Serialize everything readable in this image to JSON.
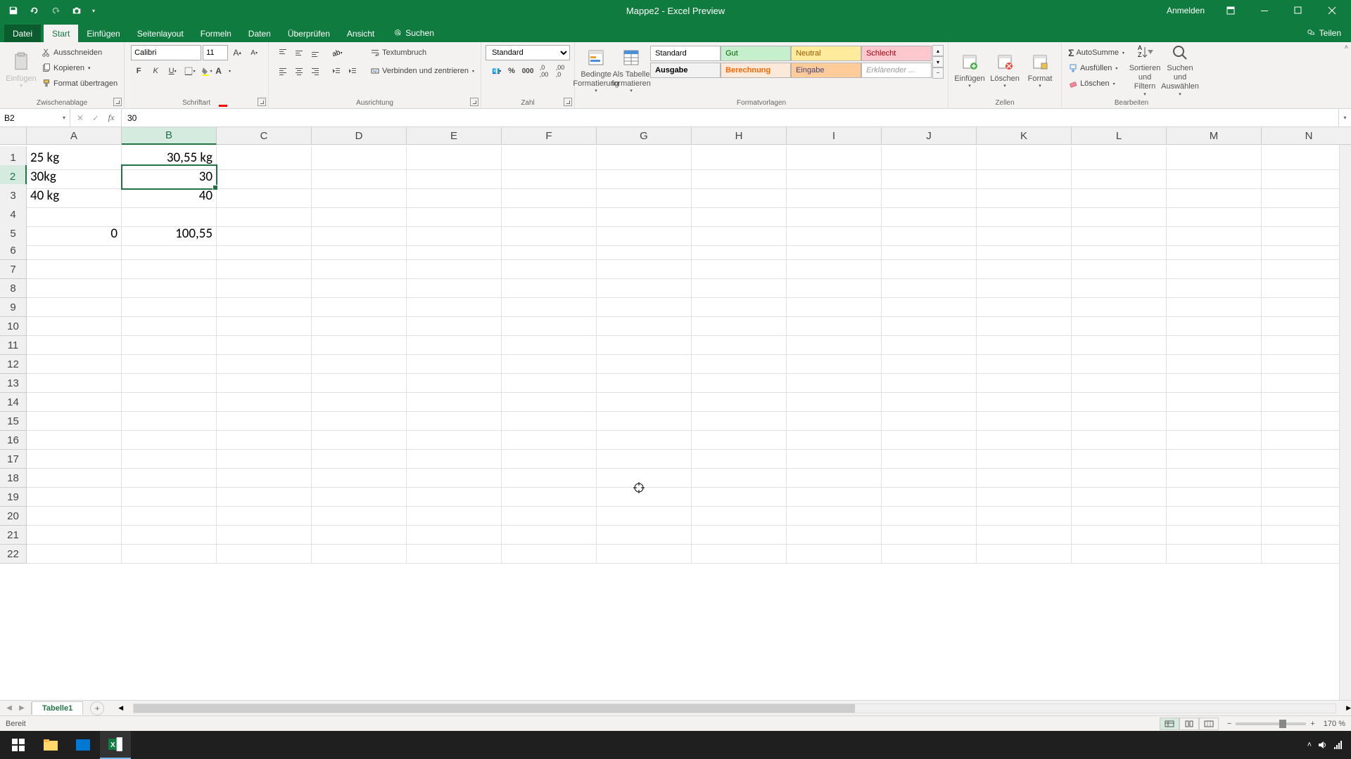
{
  "titlebar": {
    "title": "Mappe2 - Excel Preview",
    "anmelden": "Anmelden"
  },
  "tabs": {
    "datei": "Datei",
    "start": "Start",
    "einfuegen": "Einfügen",
    "seitenlayout": "Seitenlayout",
    "formeln": "Formeln",
    "daten": "Daten",
    "ueberpruefen": "Überprüfen",
    "ansicht": "Ansicht",
    "suchen": "Suchen",
    "teilen": "Teilen"
  },
  "ribbon": {
    "clipboard": {
      "label": "Zwischenablage",
      "einfuegen": "Einfügen",
      "ausschneiden": "Ausschneiden",
      "kopieren": "Kopieren",
      "format_uebertragen": "Format übertragen"
    },
    "font": {
      "label": "Schriftart",
      "name": "Calibri",
      "size": "11"
    },
    "alignment": {
      "label": "Ausrichtung",
      "textumbruch": "Textumbruch",
      "verbinden": "Verbinden und zentrieren"
    },
    "number": {
      "label": "Zahl",
      "format": "Standard"
    },
    "styles": {
      "label": "Formatvorlagen",
      "bedingte": "Bedingte Formatierung",
      "als_tabelle": "Als Tabelle formatieren",
      "standard": "Standard",
      "gut": "Gut",
      "neutral": "Neutral",
      "schlecht": "Schlecht",
      "ausgabe": "Ausgabe",
      "berechnung": "Berechnung",
      "eingabe": "Eingabe",
      "erklaerender": "Erklärender ..."
    },
    "cells": {
      "label": "Zellen",
      "einfuegen": "Einfügen",
      "loeschen": "Löschen",
      "format": "Format"
    },
    "editing": {
      "label": "Bearbeiten",
      "autosumme": "AutoSumme",
      "ausfuellen": "Ausfüllen",
      "loeschen": "Löschen",
      "sortieren": "Sortieren und Filtern",
      "suchen": "Suchen und Auswählen"
    }
  },
  "namebox": {
    "ref": "B2"
  },
  "formula": {
    "value": "30"
  },
  "columns": [
    "A",
    "B",
    "C",
    "D",
    "E",
    "F",
    "G",
    "H",
    "I",
    "J",
    "K",
    "L",
    "M",
    "N"
  ],
  "rows_count": 22,
  "active": {
    "col": "B",
    "row": 2
  },
  "cells": {
    "A1": {
      "v": "25 kg",
      "align": "left"
    },
    "B1": {
      "v": "30,55 kg",
      "align": "right"
    },
    "A2": {
      "v": "30kg",
      "align": "left"
    },
    "B2": {
      "v": "30",
      "align": "right"
    },
    "A3": {
      "v": "40 kg",
      "align": "left"
    },
    "B3": {
      "v": "40",
      "align": "right"
    },
    "A5": {
      "v": "0",
      "align": "right"
    },
    "B5": {
      "v": "100,55",
      "align": "right"
    }
  },
  "sheet": {
    "tab1": "Tabelle1"
  },
  "statusbar": {
    "ready": "Bereit",
    "zoom": "170 %"
  }
}
